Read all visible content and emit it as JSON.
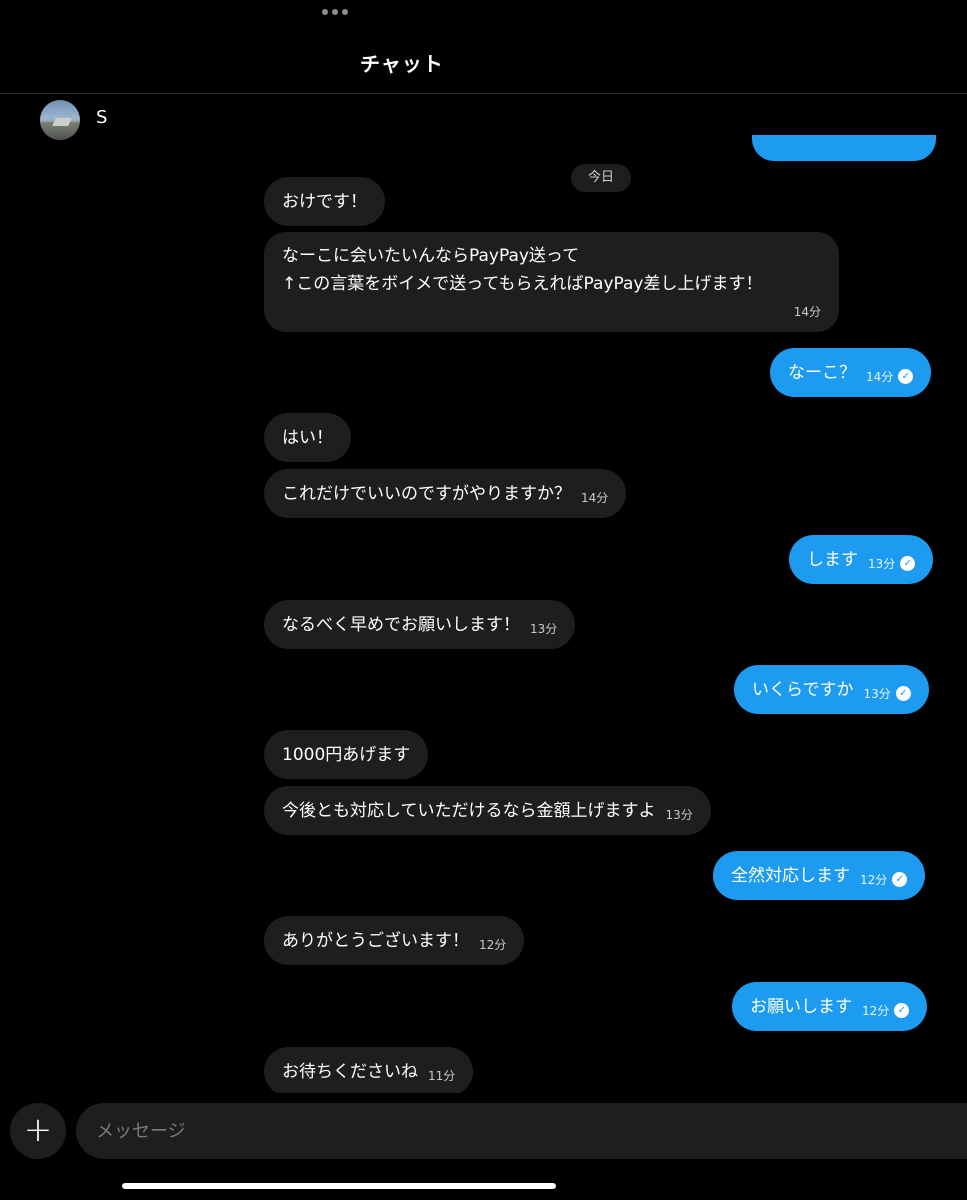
{
  "header": {
    "title": "チャット",
    "more_icon": "ellipsis-icon"
  },
  "contact": {
    "name": "S",
    "avatar": "avatar-photo"
  },
  "date_divider": "今日",
  "messages": [
    {
      "dir": "in",
      "text": "おけです！",
      "time": ""
    },
    {
      "dir": "in",
      "lines": [
        "なーこに会いたいんならPayPay送って",
        "↑この言葉をボイメで送ってもらえればPayPay差し上げます！"
      ],
      "time": "14分"
    },
    {
      "dir": "out",
      "text": "なーこ？",
      "time": "14分"
    },
    {
      "dir": "in",
      "text": "はい！",
      "time": ""
    },
    {
      "dir": "in",
      "text": "これだけでいいのですがやりますか？",
      "time": "14分"
    },
    {
      "dir": "out",
      "text": "します",
      "time": "13分"
    },
    {
      "dir": "in",
      "text": "なるべく早めでお願いします！",
      "time": "13分"
    },
    {
      "dir": "out",
      "text": "いくらですか",
      "time": "13分"
    },
    {
      "dir": "in",
      "text": "1000円あげます",
      "time": ""
    },
    {
      "dir": "in",
      "text": "今後とも対応していただけるなら金額上げますよ",
      "time": "13分"
    },
    {
      "dir": "out",
      "text": "全然対応します",
      "time": "12分"
    },
    {
      "dir": "in",
      "text": "ありがとうございます！",
      "time": "12分"
    },
    {
      "dir": "out",
      "text": "お願いします",
      "time": "12分"
    },
    {
      "dir": "in",
      "text": "お待ちくださいね",
      "time": "11分"
    }
  ],
  "composer": {
    "placeholder": "メッセージ",
    "plus_icon": "plus-icon"
  },
  "colors": {
    "background": "#000000",
    "incoming_bubble": "#1e1e1e",
    "outgoing_bubble": "#1d9bf0"
  }
}
